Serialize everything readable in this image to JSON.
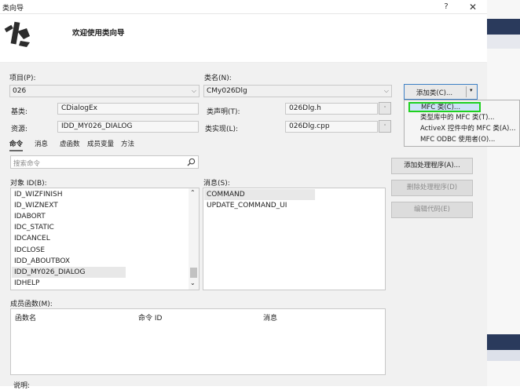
{
  "window": {
    "title": "类向导",
    "help_glyph": "?",
    "close_glyph": "✕"
  },
  "banner": {
    "welcome": "欢迎使用类向导"
  },
  "project": {
    "label": "项目(P):",
    "value": "026"
  },
  "class_name": {
    "label": "类名(N):",
    "value": "CMy026Dlg"
  },
  "add_class": {
    "label": "添加类(C)...",
    "dropdown_glyph": "▾"
  },
  "add_class_menu": [
    "MFC 类(C)...",
    "类型库中的 MFC 类(T)...",
    "ActiveX 控件中的 MFC 类(A)...",
    "MFC ODBC 使用者(O)..."
  ],
  "base_class": {
    "label": "基类:",
    "value": "CDialogEx"
  },
  "resource": {
    "label": "资源:",
    "value": "IDD_MY026_DIALOG"
  },
  "class_decl": {
    "label": "类声明(T):",
    "value": "026Dlg.h"
  },
  "class_impl": {
    "label": "类实现(L):",
    "value": "026Dlg.cpp"
  },
  "browse_glyph": "·",
  "tabs": [
    "命令",
    "消息",
    "虚函数",
    "成员变量",
    "方法"
  ],
  "search": {
    "placeholder": "搜索命令"
  },
  "object_ids": {
    "label": "对象 ID(B):",
    "items": [
      "ID_WIZFINISH",
      "ID_WIZNEXT",
      "IDABORT",
      "IDC_STATIC",
      "IDCANCEL",
      "IDCLOSE",
      "IDD_ABOUTBOX",
      "IDD_MY026_DIALOG",
      "IDHELP"
    ],
    "selected_index": 7
  },
  "messages": {
    "label": "消息(S):",
    "items": [
      "COMMAND",
      "UPDATE_COMMAND_UI"
    ]
  },
  "buttons": {
    "add_handler": "添加处理程序(A)...",
    "delete_handler": "删除处理程序(D)",
    "edit_code": "编辑代码(E)"
  },
  "member_functions": {
    "label": "成员函数(M):",
    "columns": [
      "函数名",
      "命令 ID",
      "消息"
    ]
  },
  "description": {
    "label": "说明:"
  },
  "colors": {
    "highlight_border": "#1fd11f",
    "accent": "#3c7fc4"
  }
}
